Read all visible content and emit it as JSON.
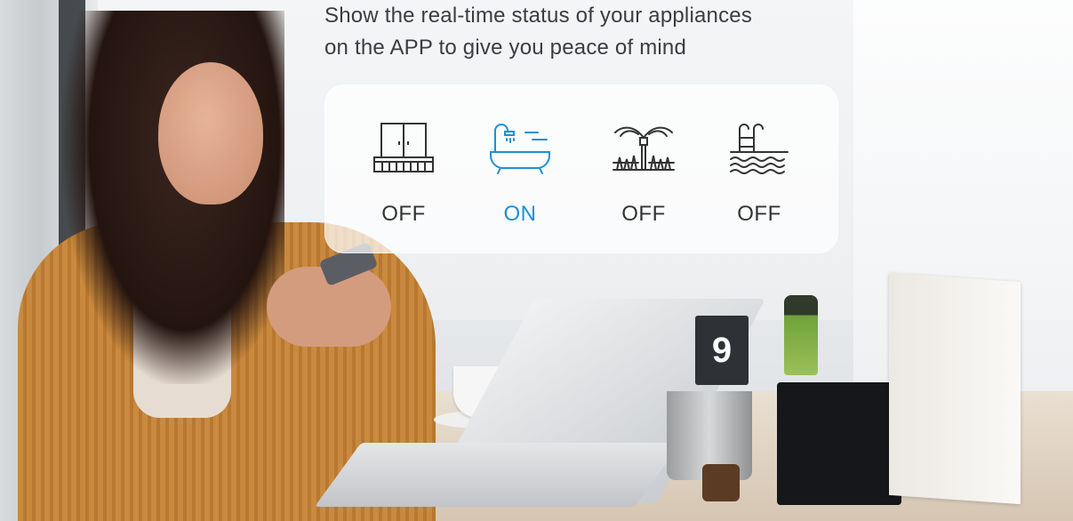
{
  "headline": {
    "line1": "Show the real-time status of your appliances",
    "line2": "on the APP to give you peace of mind"
  },
  "devices": [
    {
      "icon": "window-gate-icon",
      "status": "OFF"
    },
    {
      "icon": "bathtub-shower-icon",
      "status": "ON"
    },
    {
      "icon": "garden-sprinkler-icon",
      "status": "OFF"
    },
    {
      "icon": "pool-ladder-icon",
      "status": "OFF"
    }
  ],
  "background": {
    "table_number": "9"
  },
  "colors": {
    "on_color": "#1e90d8",
    "off_color": "#333333",
    "icon_color": "#333333"
  }
}
